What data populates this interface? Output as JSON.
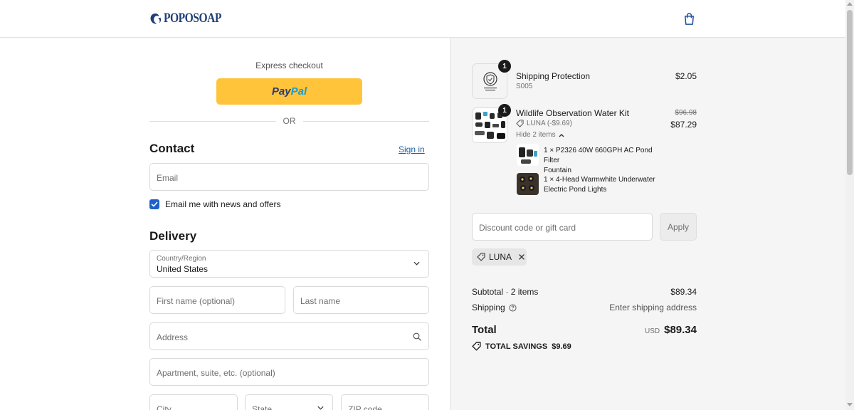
{
  "brand": {
    "name": "POPOSOAP",
    "color": "#1f3f77"
  },
  "express": {
    "title": "Express checkout",
    "paypal_a": "Pay",
    "paypal_b": "Pal",
    "or": "OR"
  },
  "contact": {
    "title": "Contact",
    "sign_in": "Sign in",
    "email_placeholder": "Email",
    "newsletter_label": "Email me with news and offers",
    "newsletter_checked": true
  },
  "delivery": {
    "title": "Delivery",
    "country_label": "Country/Region",
    "country_value": "United States",
    "first_name_placeholder": "First name (optional)",
    "last_name_placeholder": "Last name",
    "address_placeholder": "Address",
    "apartment_placeholder": "Apartment, suite, etc. (optional)",
    "city_placeholder": "City",
    "state_placeholder": "State",
    "zip_placeholder": "ZIP code"
  },
  "cart": {
    "items": [
      {
        "name": "Shipping Protection",
        "sku": "S005",
        "quantity": "1",
        "price": "$2.05",
        "thumb_caption": "Shipping Protection"
      },
      {
        "name": "Wildlife Observation Water Kit",
        "discount": "LUNA (-$9.69)",
        "quantity": "1",
        "price_original": "$96.98",
        "price": "$87.29",
        "toggle": "Hide 2 items"
      }
    ],
    "bundle": [
      {
        "line1": "1 × P2326 40W 660GPH AC Pond Filter",
        "line2": "Fountain"
      },
      {
        "line1": "1 × 4-Head Warmwhite Underwater",
        "line2": "Electric Pond Lights"
      }
    ]
  },
  "discount": {
    "placeholder": "Discount code or gift card",
    "apply": "Apply",
    "applied_code": "LUNA"
  },
  "summary": {
    "subtotal_label": "Subtotal · 2 items",
    "subtotal_value": "$89.34",
    "shipping_label": "Shipping",
    "shipping_value": "Enter shipping address",
    "total_label": "Total",
    "currency": "USD",
    "total_value": "$89.34",
    "savings_label": "TOTAL SAVINGS",
    "savings_value": "$9.69"
  },
  "colors": {
    "paypal": "#ffc439",
    "link": "#1f5f9e",
    "checkbox": "#1f5fc7",
    "sidebar_bg": "#f5f5f5"
  }
}
